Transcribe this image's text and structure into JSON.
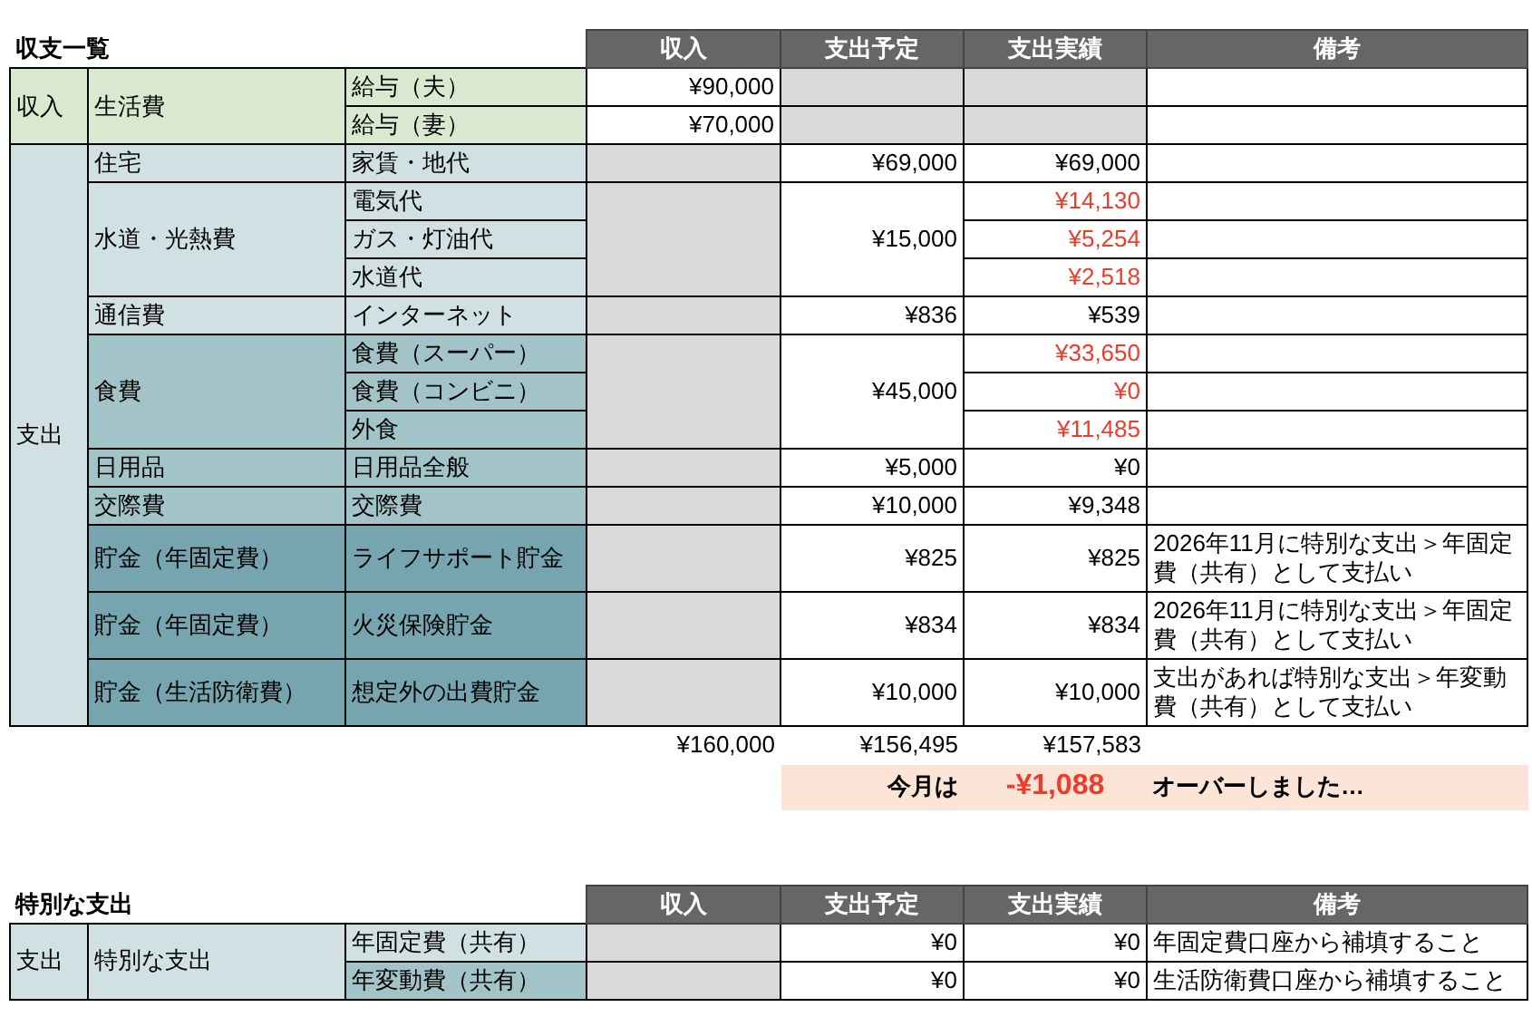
{
  "tables": [
    {
      "title": "収支一覧",
      "columns": [
        "収入",
        "支出予定",
        "支出実績",
        "備考"
      ],
      "sections": [
        {
          "label": "収入",
          "color": "#d8e9d0",
          "groups": [
            {
              "label": "生活費",
              "color": "#d8e9d0",
              "items": [
                {
                  "label": "給与（夫）",
                  "color": "#d8e9d0",
                  "income": "¥90,000"
                },
                {
                  "label": "給与（妻）",
                  "color": "#d8e9d0",
                  "income": "¥70,000"
                }
              ]
            }
          ]
        },
        {
          "label": "支出",
          "color": "#d0e0e3",
          "groups": [
            {
              "label": "住宅",
              "color": "#d0e0e3",
              "items": [
                {
                  "label": "家賃・地代",
                  "color": "#d0e0e3",
                  "planned": "¥69,000",
                  "actual": "¥69,000",
                  "over": false
                }
              ]
            },
            {
              "label": "水道・光熱費",
              "color": "#d0e0e3",
              "planned": "¥15,000",
              "items": [
                {
                  "label": "電気代",
                  "color": "#d0e0e3",
                  "actual": "¥14,130",
                  "over": true
                },
                {
                  "label": "ガス・灯油代",
                  "color": "#d0e0e3",
                  "actual": "¥5,254",
                  "over": true
                },
                {
                  "label": "水道代",
                  "color": "#d0e0e3",
                  "actual": "¥2,518",
                  "over": true
                }
              ]
            },
            {
              "label": "通信費",
              "color": "#d0e0e3",
              "items": [
                {
                  "label": "インターネット",
                  "color": "#d0e0e3",
                  "planned": "¥836",
                  "actual": "¥539",
                  "over": false
                }
              ]
            },
            {
              "label": "食費",
              "color": "#a2c4c9",
              "planned": "¥45,000",
              "items": [
                {
                  "label": "食費（スーパー）",
                  "color": "#a2c4c9",
                  "actual": "¥33,650",
                  "over": true
                },
                {
                  "label": "食費（コンビニ）",
                  "color": "#a2c4c9",
                  "actual": "¥0",
                  "over": true
                },
                {
                  "label": "外食",
                  "color": "#a2c4c9",
                  "actual": "¥11,485",
                  "over": true
                }
              ]
            },
            {
              "label": "日用品",
              "color": "#a2c4c9",
              "items": [
                {
                  "label": "日用品全般",
                  "color": "#a2c4c9",
                  "planned": "¥5,000",
                  "actual": "¥0",
                  "over": false
                }
              ]
            },
            {
              "label": "交際費",
              "color": "#a2c4c9",
              "items": [
                {
                  "label": "交際費",
                  "color": "#a2c4c9",
                  "planned": "¥10,000",
                  "actual": "¥9,348",
                  "over": false
                }
              ]
            },
            {
              "label": "貯金（年固定費）",
              "color": "#76a5af",
              "items": [
                {
                  "label": "ライフサポート貯金",
                  "color": "#76a5af",
                  "planned": "¥825",
                  "actual": "¥825",
                  "over": false,
                  "note": "2026年11月に特別な支出＞年固定費（共有）として支払い"
                }
              ]
            },
            {
              "label": "貯金（年固定費）",
              "color": "#76a5af",
              "items": [
                {
                  "label": "火災保険貯金",
                  "color": "#76a5af",
                  "planned": "¥834",
                  "actual": "¥834",
                  "over": false,
                  "note": "2026年11月に特別な支出＞年固定費（共有）として支払い"
                }
              ]
            },
            {
              "label": "貯金（生活防衛費）",
              "color": "#76a5af",
              "items": [
                {
                  "label": "想定外の出費貯金",
                  "color": "#76a5af",
                  "planned": "¥10,000",
                  "actual": "¥10,000",
                  "over": false,
                  "note": "支出があれば特別な支出＞年変動費（共有）として支払い"
                }
              ]
            }
          ]
        }
      ],
      "totals": {
        "income": "¥160,000",
        "planned": "¥156,495",
        "actual": "¥157,583"
      },
      "summary": {
        "label": "今月は",
        "amount": "-¥1,088",
        "message": "オーバーしました…"
      }
    },
    {
      "title": "特別な支出",
      "columns": [
        "収入",
        "支出予定",
        "支出実績",
        "備考"
      ],
      "sections": [
        {
          "label": "支出",
          "color": "#d0e0e3",
          "groups": [
            {
              "label": "特別な支出",
              "color": "#d0e0e3",
              "items": [
                {
                  "label": "年固定費（共有）",
                  "color": "#d0e0e3",
                  "planned": "¥0",
                  "actual": "¥0",
                  "over": false,
                  "note": "年固定費口座から補填すること"
                },
                {
                  "label": "年変動費（共有）",
                  "color": "#a2c4c9",
                  "planned": "¥0",
                  "actual": "¥0",
                  "over": false,
                  "note": "生活防衛費口座から補填すること"
                }
              ]
            }
          ]
        }
      ]
    }
  ]
}
